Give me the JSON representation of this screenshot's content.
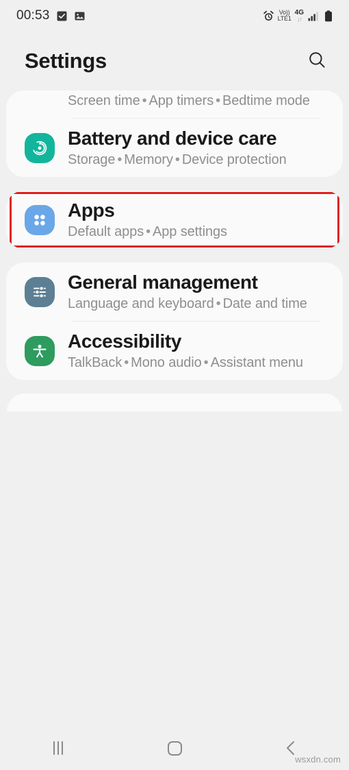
{
  "status_bar": {
    "clock": "00:53",
    "left_icons": [
      {
        "name": "checkbox-checked-icon",
        "glyph": "☑"
      },
      {
        "name": "image-icon",
        "glyph": "ὛC"
      }
    ],
    "alarm_icon": "alarm-icon",
    "volte": {
      "top": "Vo))",
      "bottom": "LTE1"
    },
    "network": {
      "type": "4G",
      "arrows": "↓↑"
    },
    "signal_icon": "signal-bars-icon",
    "battery_icon": "battery-full-icon"
  },
  "header": {
    "title": "Settings",
    "search_icon": "search-icon"
  },
  "cards": [
    {
      "id": "card-one",
      "rows": [
        {
          "id": "digital-wellbeing",
          "clipped": true,
          "title": "",
          "subtitle_parts": [
            "Screen time",
            "App timers",
            "Bedtime mode"
          ],
          "icon": {
            "name": "digital-wellbeing-icon",
            "bg": ""
          },
          "divider_after": true
        },
        {
          "id": "battery-and-device-care",
          "clipped": false,
          "title": "Battery and device care",
          "subtitle_parts": [
            "Storage",
            "Memory",
            "Device protection"
          ],
          "icon": {
            "name": "battery-device-care-icon",
            "bg": "#12b59b"
          },
          "divider_after": false
        }
      ]
    },
    {
      "id": "card-apps",
      "highlighted": true,
      "highlight_color": "#e02020",
      "rows": [
        {
          "id": "apps",
          "clipped": false,
          "title": "Apps",
          "subtitle_parts": [
            "Default apps",
            "App settings"
          ],
          "icon": {
            "name": "apps-icon",
            "bg": "#6aa7e8"
          },
          "divider_after": false
        }
      ]
    },
    {
      "id": "card-three",
      "rows": [
        {
          "id": "general-management",
          "clipped": false,
          "title": "General management",
          "subtitle_parts": [
            "Language and keyboard",
            "Date and time"
          ],
          "icon": {
            "name": "general-management-icon",
            "bg": "#5d7f94"
          },
          "divider_after": true
        },
        {
          "id": "accessibility",
          "clipped": false,
          "title": "Accessibility",
          "subtitle_parts": [
            "TalkBack",
            "Mono audio",
            "Assistant menu"
          ],
          "icon": {
            "name": "accessibility-icon",
            "bg": "#2e9c5e"
          },
          "divider_after": false
        }
      ]
    }
  ],
  "nav_bar": {
    "recents_label": "recents-button",
    "home_label": "home-button",
    "back_label": "back-button"
  },
  "watermark": "wsxdn.com",
  "colors": {
    "page_bg": "#f0f0f0",
    "card_bg": "#fafafa",
    "title_text": "#1a1a1a",
    "subtitle_text": "#8e8e8e",
    "highlight_red": "#e02020"
  }
}
